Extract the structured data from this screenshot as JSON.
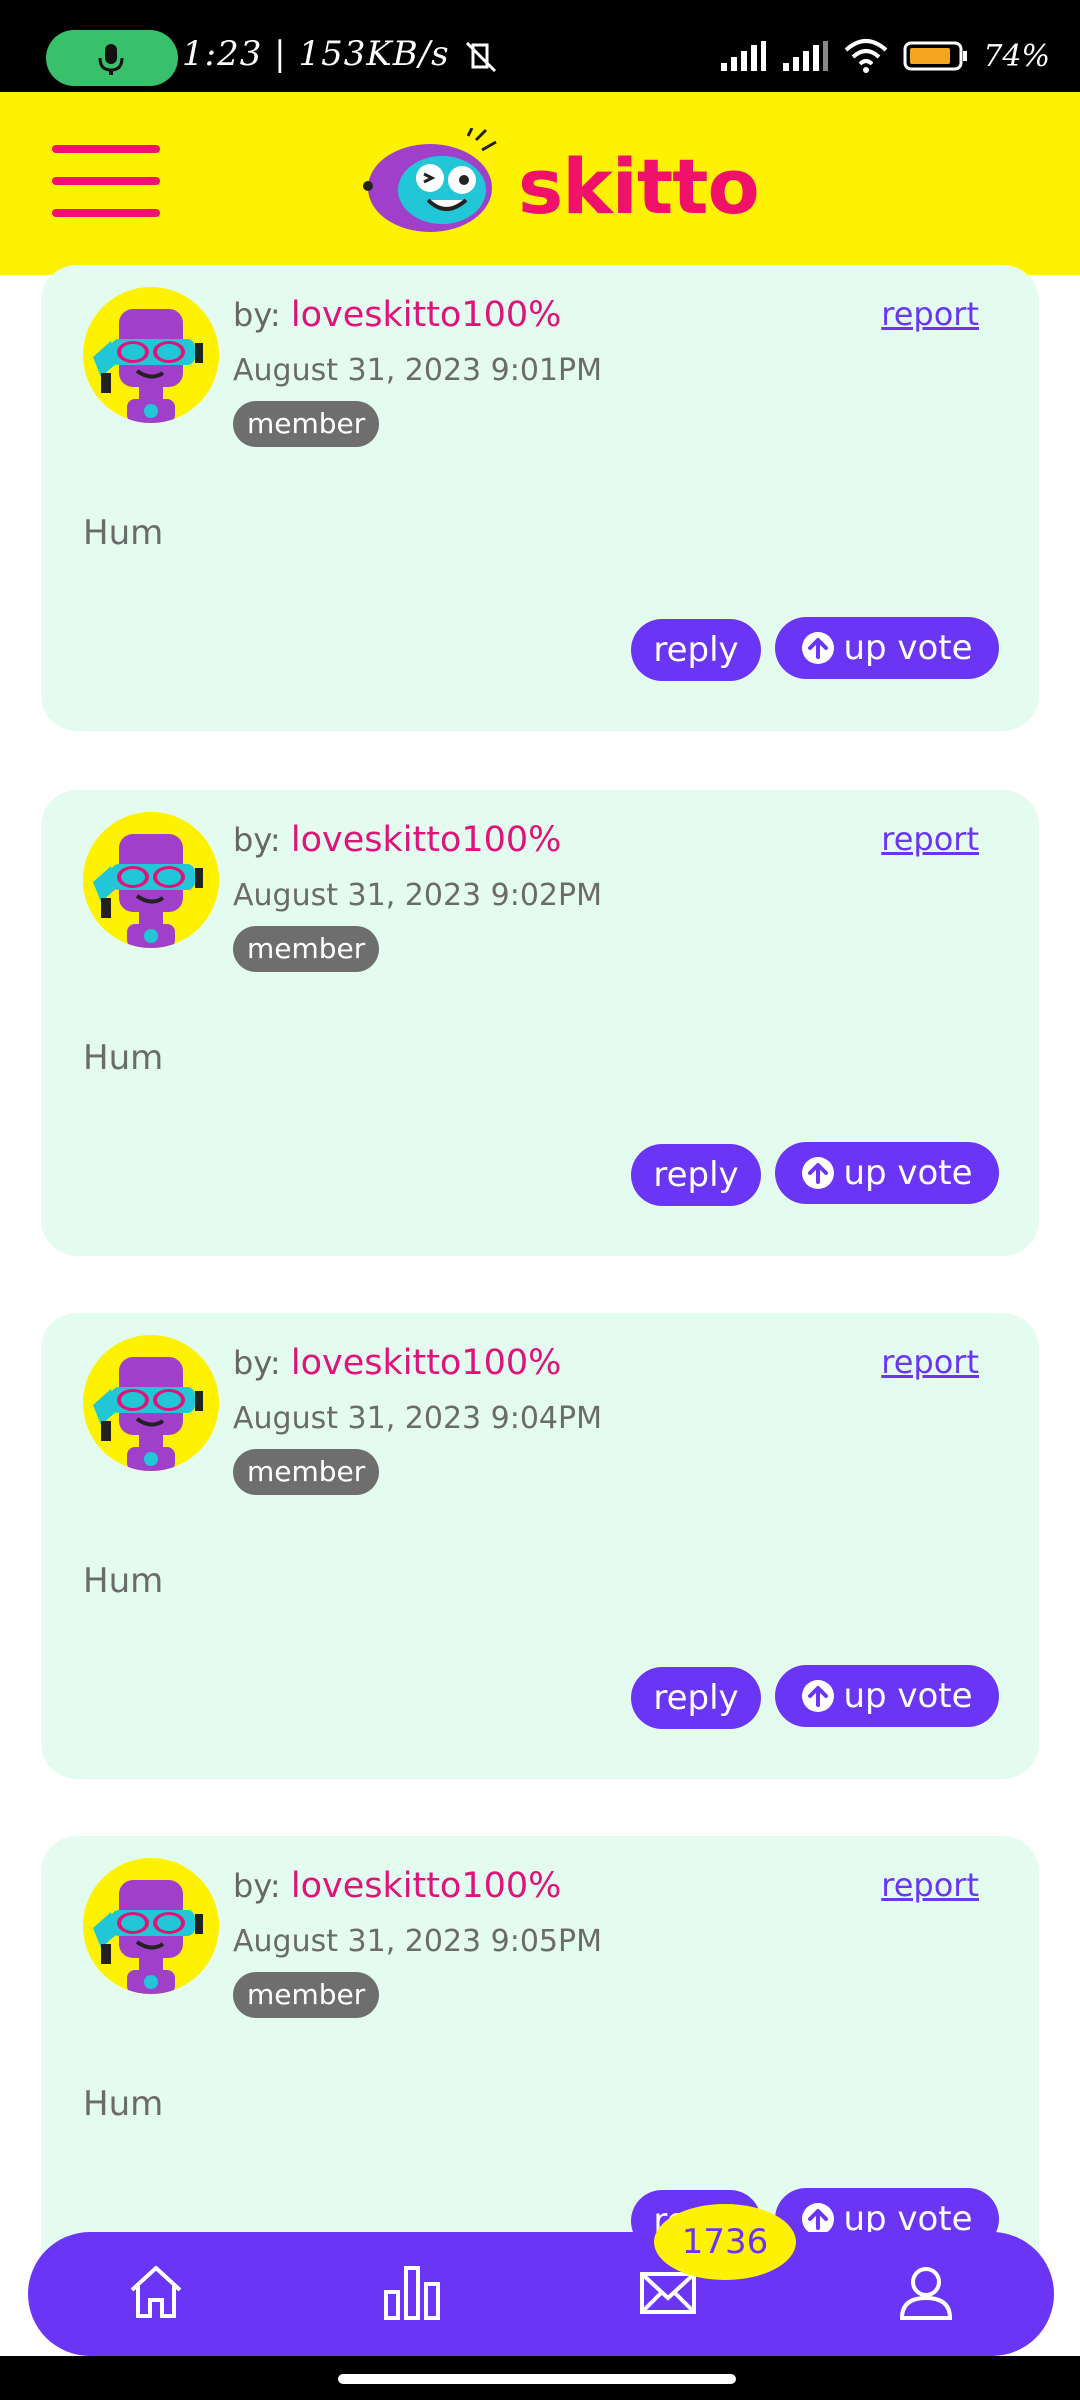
{
  "status_bar": {
    "time": "1:23",
    "network_speed": "153KB/s",
    "battery": "74%"
  },
  "header": {
    "logo_text": "skitto"
  },
  "comments": [
    {
      "by_prefix": "by:",
      "username": "loveskitto100%",
      "date": "August 31, 2023 9:01PM",
      "role": "member",
      "report": "report",
      "text": "Hum",
      "reply": "reply",
      "upvote": "up vote"
    },
    {
      "by_prefix": "by:",
      "username": "loveskitto100%",
      "date": "August 31, 2023 9:02PM",
      "role": "member",
      "report": "report",
      "text": "Hum",
      "reply": "reply",
      "upvote": "up vote"
    },
    {
      "by_prefix": "by:",
      "username": "loveskitto100%",
      "date": "August 31, 2023 9:04PM",
      "role": "member",
      "report": "report",
      "text": "Hum",
      "reply": "reply",
      "upvote": "up vote"
    },
    {
      "by_prefix": "by:",
      "username": "loveskitto100%",
      "date": "August 31, 2023 9:05PM",
      "role": "member",
      "report": "report",
      "text": "Hum",
      "reply": "reply",
      "upvote": "up vote"
    }
  ],
  "bottom_nav": {
    "items": [
      {
        "icon": "home-icon"
      },
      {
        "icon": "bar-chart-icon"
      },
      {
        "icon": "mail-icon"
      },
      {
        "icon": "profile-icon"
      }
    ],
    "badge_count": "1736"
  },
  "colors": {
    "brand_yellow": "#fff200",
    "brand_pink": "#f0116b",
    "brand_purple": "#6a35f5",
    "card_bg": "#e4fbef"
  }
}
